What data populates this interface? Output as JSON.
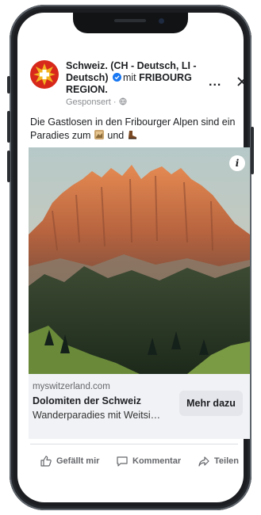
{
  "post": {
    "page_name": "Schweiz. (CH - Deutsch, LI - Deutsch)",
    "with_text": "mit",
    "partner": "FRIBOURG REGION.",
    "sponsored": "Gesponsert ·",
    "text_line1": "Die Gastlosen in den Fribourger Alpen sind ein",
    "text_line2_prefix": "Paradies zum",
    "text_line2_mid": "und",
    "more_label": "...",
    "info_label": "i"
  },
  "link": {
    "domain": "myswitzerland.com",
    "headline": "Dolomiten der Schweiz",
    "description": "Wanderparadies mit Weitsi…",
    "cta_label": "Mehr dazu"
  },
  "actions": {
    "like": "Gefällt mir",
    "comment": "Kommentar",
    "share": "Teilen"
  },
  "colors": {
    "brand_red": "#d7281b",
    "verified_blue": "#1877f2",
    "link_bar_bg": "#f0f2f5"
  }
}
